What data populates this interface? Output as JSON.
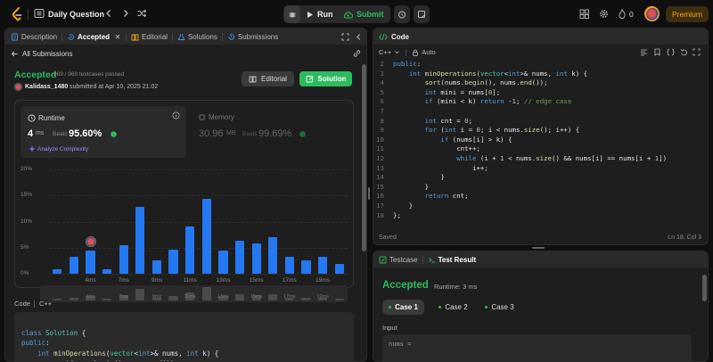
{
  "topbar": {
    "title": "Daily Question",
    "run_label": "Run",
    "submit_label": "Submit",
    "coins": "0",
    "premium_label": "Premium"
  },
  "left_tabs": [
    {
      "label": "Description"
    },
    {
      "label": "Accepted"
    },
    {
      "label": "Editorial"
    },
    {
      "label": "Solutions"
    },
    {
      "label": "Submissions"
    }
  ],
  "submission": {
    "back_label": "All Submissions",
    "status": "Accepted",
    "testcases": "969 / 969 testcases passed",
    "user": "Kalidass_1480",
    "submitted_at": "submitted at Apr 10, 2025 21:02",
    "editorial_btn": "Editorial",
    "solution_btn": "Solution",
    "runtime_label": "Runtime",
    "runtime_value": "4",
    "runtime_unit": "ms",
    "beats_label": "Beats",
    "runtime_beats": "95.60%",
    "analyze_label": "Analyze Complexity",
    "memory_label": "Memory",
    "memory_value": "30.96",
    "memory_unit": "MB",
    "memory_beats": "99.69%"
  },
  "chart_data": {
    "type": "bar",
    "y_ticks": [
      "20%",
      "15%",
      "10%",
      "5%",
      "0%"
    ],
    "ylim": [
      0,
      20
    ],
    "x_ticks": [
      "4ms",
      "7ms",
      "9ms",
      "11ms",
      "13ms",
      "15ms",
      "17ms",
      "19ms"
    ],
    "values": [
      0.8,
      3.3,
      4.5,
      0.8,
      5.5,
      12.8,
      2.6,
      4.6,
      9.0,
      14.3,
      4.5,
      6.4,
      5.8,
      7.0,
      3.2,
      2.5,
      3.2,
      1.8
    ],
    "highlight_index": 2
  },
  "code_section": {
    "label": "Code",
    "lang": "C++"
  },
  "left_code": [
    "class Solution {",
    "public:",
    "    int minOperations(vector<int>& nums, int k) {",
    "        sort(nums.begin(), nums.end());"
  ],
  "editor": {
    "title": "Code",
    "lang": "C++",
    "mode": "Auto",
    "status_left": "Saved",
    "status_right": "Ln 18, Col 3",
    "line_numbers": [
      "2",
      "3",
      "4",
      "5",
      "6",
      "7",
      "8",
      "9",
      "10",
      "11",
      "12",
      "13",
      "14",
      "15",
      "16",
      "17",
      "18"
    ]
  },
  "testpanel": {
    "tab_testcase": "Testcase",
    "tab_result": "Test Result",
    "status": "Accepted",
    "runtime": "Runtime: 3 ms",
    "cases": [
      "Case 1",
      "Case 2",
      "Case 3"
    ],
    "input_label": "Input",
    "var_label": "nums ="
  },
  "colors": {
    "accent_green": "#2cbb5d",
    "bar_blue": "#2478f2",
    "premium": "#ffa116"
  }
}
